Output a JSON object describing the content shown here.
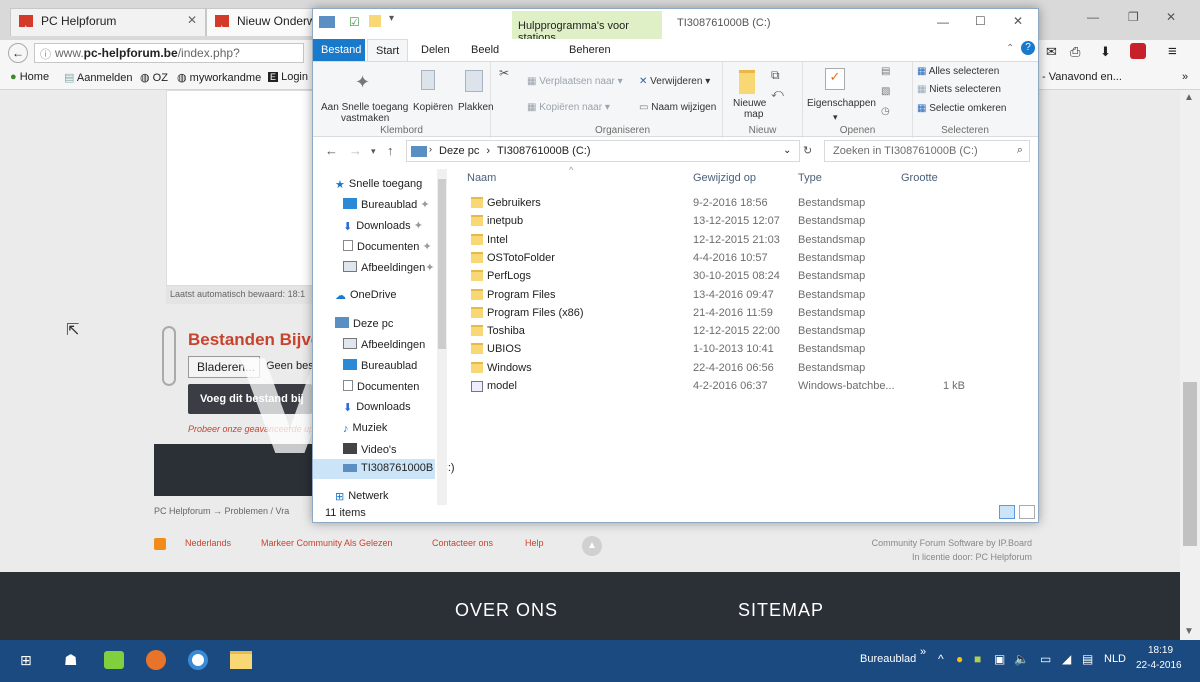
{
  "browser": {
    "tabs": [
      {
        "label": "PC Helpforum"
      },
      {
        "label": "Nieuw Onderwerp"
      }
    ],
    "url": {
      "domain_prefix": "www.",
      "domain": "pc-helpforum.be",
      "path": "/index.php?"
    },
    "bookmarks": [
      "Home",
      "Aanmelden",
      "OZ",
      "myworkandme",
      "Login"
    ],
    "right_bookmark": "- Vanavond en..."
  },
  "forum": {
    "autosave": "Laatst automatisch bewaard: 18:1",
    "attach_title": "Bestanden Bijvo",
    "browse_button": "Bladeren...",
    "no_file": "Geen best",
    "add_button": "Voeg dit bestand bij",
    "advanced_text": "Probeer onze geavanceerde up",
    "breadcrumb": "PC Helpforum  →  Problemen / Vra",
    "footer_links": [
      "Nederlands",
      "Markeer Community Als Gelezen",
      "Contacteer ons",
      "Help"
    ],
    "credits_1": "Community Forum Software by IP.Board",
    "credits_2": "In licentie door: PC Helpforum",
    "over_ons": "OVER ONS",
    "sitemap": "SITEMAP",
    "watermark": "DEMO VERSION"
  },
  "explorer": {
    "contextual_tab": "Hulpprogramma's voor stations",
    "title": "TI308761000B (C:)",
    "tabs": [
      "Bestand",
      "Start",
      "Delen",
      "Beeld",
      "Beheren"
    ],
    "ribbon": {
      "pin_label_1": "Aan Snelle toegang",
      "pin_label_2": "vastmaken",
      "copy": "Kopiëren",
      "paste": "Plakken",
      "move_to": "Verplaatsen naar",
      "copy_to": "Kopiëren naar",
      "delete": "Verwijderen",
      "rename": "Naam wijzigen",
      "new_folder_1": "Nieuwe",
      "new_folder_2": "map",
      "properties": "Eigenschappen",
      "select_all": "Alles selecteren",
      "select_none": "Niets selecteren",
      "invert": "Selectie omkeren",
      "groups": [
        "Klembord",
        "Organiseren",
        "Nieuw",
        "Openen",
        "Selecteren"
      ]
    },
    "address": {
      "part1": "Deze pc",
      "part2": "TI308761000B (C:)"
    },
    "search_placeholder": "Zoeken in TI308761000B (C:)",
    "nav": [
      {
        "label": "Snelle toegang",
        "icon": "star-icon"
      },
      {
        "label": "Bureaublad",
        "icon": "desktop-icon"
      },
      {
        "label": "Downloads",
        "icon": "download-icon"
      },
      {
        "label": "Documenten",
        "icon": "document-icon"
      },
      {
        "label": "Afbeeldingen",
        "icon": "pictures-icon"
      },
      {
        "label": "OneDrive",
        "icon": "cloud-icon"
      },
      {
        "label": "Deze pc",
        "icon": "pc-icon"
      },
      {
        "label": "Afbeeldingen",
        "icon": "pictures-icon"
      },
      {
        "label": "Bureaublad",
        "icon": "desktop-icon"
      },
      {
        "label": "Documenten",
        "icon": "document-icon"
      },
      {
        "label": "Downloads",
        "icon": "download-icon"
      },
      {
        "label": "Muziek",
        "icon": "music-icon"
      },
      {
        "label": "Video's",
        "icon": "video-icon"
      },
      {
        "label": "TI308761000B (C:)",
        "icon": "drive-icon"
      },
      {
        "label": "Netwerk",
        "icon": "network-icon"
      }
    ],
    "columns": [
      "Naam",
      "Gewijzigd op",
      "Type",
      "Grootte"
    ],
    "files": [
      {
        "name": "Gebruikers",
        "date": "9-2-2016 18:56",
        "type": "Bestandsmap",
        "size": ""
      },
      {
        "name": "inetpub",
        "date": "13-12-2015 12:07",
        "type": "Bestandsmap",
        "size": ""
      },
      {
        "name": "Intel",
        "date": "12-12-2015 21:03",
        "type": "Bestandsmap",
        "size": ""
      },
      {
        "name": "OSTotoFolder",
        "date": "4-4-2016 10:57",
        "type": "Bestandsmap",
        "size": ""
      },
      {
        "name": "PerfLogs",
        "date": "30-10-2015 08:24",
        "type": "Bestandsmap",
        "size": ""
      },
      {
        "name": "Program Files",
        "date": "13-4-2016 09:47",
        "type": "Bestandsmap",
        "size": ""
      },
      {
        "name": "Program Files (x86)",
        "date": "21-4-2016 11:59",
        "type": "Bestandsmap",
        "size": ""
      },
      {
        "name": "Toshiba",
        "date": "12-12-2015 22:00",
        "type": "Bestandsmap",
        "size": ""
      },
      {
        "name": "UBIOS",
        "date": "1-10-2013 10:41",
        "type": "Bestandsmap",
        "size": ""
      },
      {
        "name": "Windows",
        "date": "22-4-2016 06:56",
        "type": "Bestandsmap",
        "size": ""
      },
      {
        "name": "model",
        "date": "4-2-2016 06:37",
        "type": "Windows-batchbe...",
        "size": "1 kB"
      }
    ],
    "status": "11 items"
  },
  "taskbar": {
    "desktop_label": "Bureaublad",
    "lang": "NLD",
    "time": "18:19",
    "date": "22-4-2016"
  },
  "colors": {
    "taskbar": "#1b4a80",
    "ribbon_file_tab": "#1979ca",
    "context_tab": "#dff0c6",
    "footer_dark": "#2b2f36"
  }
}
